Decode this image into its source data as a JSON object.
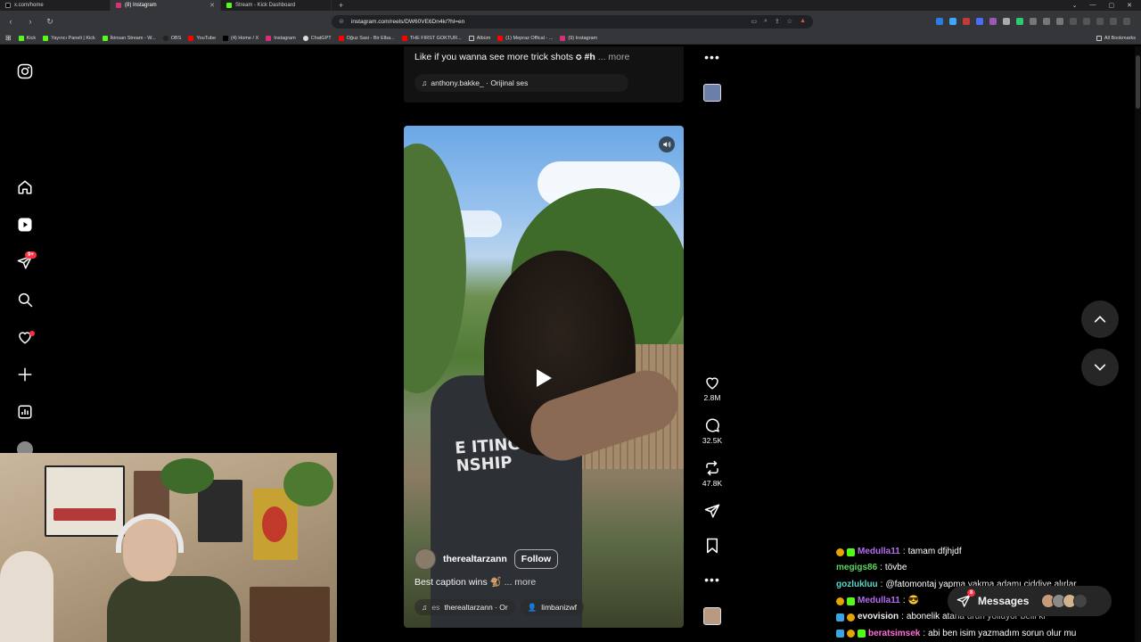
{
  "browser": {
    "tabs": [
      {
        "label": "x.com/home",
        "active": false
      },
      {
        "label": "(8) Instagram",
        "active": true
      },
      {
        "label": "Stream - Kick Dashboard",
        "active": false
      }
    ],
    "url": "instagram.com/reels/DW60VE6Dn4k/?hl=en",
    "bookmarks": [
      "Kick",
      "Yayıncı Paneli | Kick",
      "İkinsan Stream - W...",
      "OBS",
      "YouTube",
      "(4) Home / X",
      "Instagram",
      "ChatGPT",
      "Oğuz Sasi - Bir Elba...",
      "THE FIRST GOKTUR...",
      "Albüm",
      "(1) Mepraz Offical - ...",
      "(9) Instagram"
    ],
    "all_bookmarks": "All Bookmarks"
  },
  "sidebar": {
    "logo_icon": "instagram-icon",
    "items": [
      {
        "name": "home",
        "icon": "home-icon"
      },
      {
        "name": "reels",
        "icon": "reels-icon"
      },
      {
        "name": "messages",
        "icon": "send-icon",
        "badge": "9+"
      },
      {
        "name": "search",
        "icon": "search-icon"
      },
      {
        "name": "notifications",
        "icon": "heart-icon"
      },
      {
        "name": "create",
        "icon": "plus-icon"
      },
      {
        "name": "dashboard",
        "icon": "dashboard-icon"
      }
    ]
  },
  "previous_reel": {
    "caption": "Like if you wanna see more trick shots",
    "caption_tag": "#h",
    "more": "... more",
    "audio": "anthony.bakke_ · Orijinal ses"
  },
  "reel": {
    "username": "therealtarzann",
    "follow_label": "Follow",
    "caption": "Best caption wins",
    "more": "... more",
    "audio_user": "therealtarzann · Or",
    "audio_prefix": "es",
    "tagged_user": "limbanizwf",
    "shirt_text_1": "E ITING",
    "shirt_text_2": "NSHIP"
  },
  "actions": {
    "likes": "2.8M",
    "comments": "32.5K",
    "reposts": "47.8K"
  },
  "chat": [
    {
      "user": "Medulla11",
      "user_color": "#b46cf0",
      "message": "tamam dfjhjdf"
    },
    {
      "user": "megigs86",
      "user_color": "#5ad65a",
      "message": "tövbe"
    },
    {
      "user": "gozlukluu",
      "user_color": "#5ad6c8",
      "message": "@fatomontaj yapma yakma adamı ciddiye alırlar"
    },
    {
      "user": "Medulla11",
      "user_color": "#b46cf0",
      "message": "😎"
    },
    {
      "user": "evovision",
      "user_color": "#f0f0f0",
      "message": "abonelik atana ürün yolluyor belli ki"
    },
    {
      "user": "beratsimsek",
      "user_color": "#ff6fd8",
      "message": "abi ben isim yazmadım sorun olur mu"
    }
  ],
  "messages_widget": {
    "label": "Messages",
    "badge": "8"
  }
}
